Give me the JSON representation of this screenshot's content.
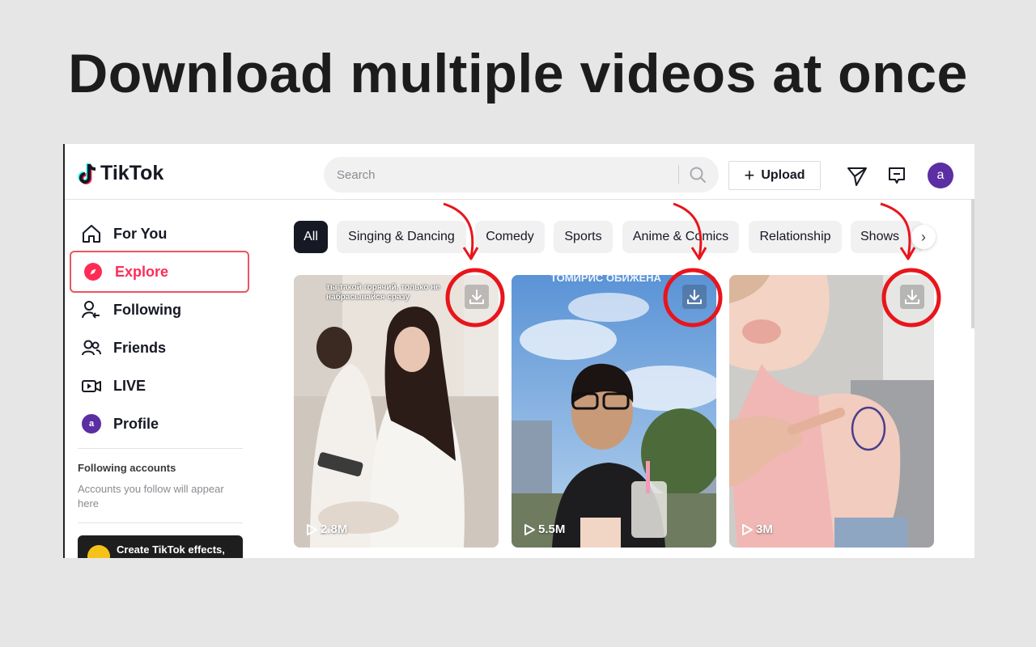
{
  "headline": "Download multiple videos at once",
  "header": {
    "logo_text": "TikTok",
    "search_placeholder": "Search",
    "upload_label": "Upload",
    "avatar_letter": "a"
  },
  "sidebar": {
    "items": [
      {
        "label": "For You",
        "icon": "home-icon"
      },
      {
        "label": "Explore",
        "icon": "compass-icon",
        "active": true
      },
      {
        "label": "Following",
        "icon": "following-icon"
      },
      {
        "label": "Friends",
        "icon": "friends-icon"
      },
      {
        "label": "LIVE",
        "icon": "live-icon"
      },
      {
        "label": "Profile",
        "icon": "avatar"
      }
    ],
    "profile_avatar_letter": "a",
    "following_title": "Following accounts",
    "following_sub": "Accounts you follow will appear here",
    "effects_label": "Create TikTok effects,"
  },
  "categories": [
    "All",
    "Singing & Dancing",
    "Comedy",
    "Sports",
    "Anime & Comics",
    "Relationship",
    "Shows"
  ],
  "videos": [
    {
      "views": "2.8M",
      "caption": "ты такой горячий, только не набрасывайся сразу"
    },
    {
      "views": "5.5M",
      "caption": "ТОМИРИС ОБИЖЕНА"
    },
    {
      "views": "3M",
      "caption": ""
    }
  ],
  "colors": {
    "accent": "#fe2c55",
    "highlight": "#e8151b",
    "avatar": "#5b2ea3"
  }
}
